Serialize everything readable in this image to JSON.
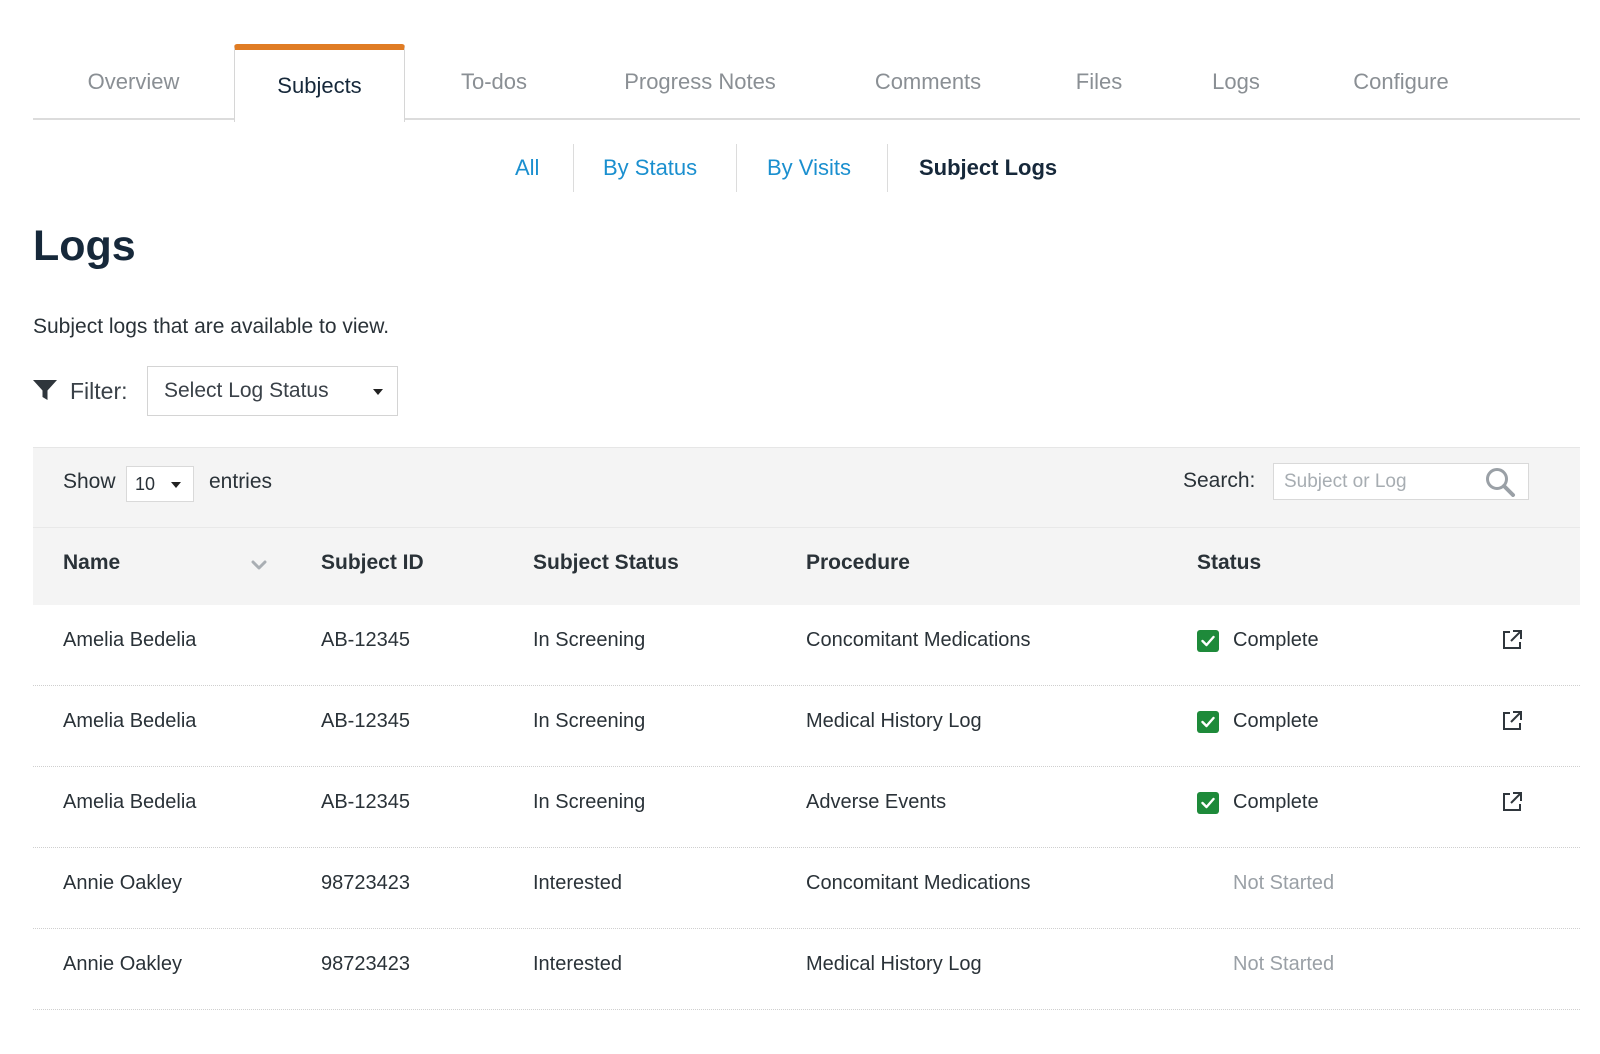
{
  "tabs": [
    {
      "label": "Overview",
      "active": false
    },
    {
      "label": "Subjects",
      "active": true
    },
    {
      "label": "To-dos",
      "active": false
    },
    {
      "label": "Progress Notes",
      "active": false
    },
    {
      "label": "Comments",
      "active": false
    },
    {
      "label": "Files",
      "active": false
    },
    {
      "label": "Logs",
      "active": false
    },
    {
      "label": "Configure",
      "active": false
    }
  ],
  "subtabs": [
    {
      "label": "All",
      "active": false
    },
    {
      "label": "By Status",
      "active": false
    },
    {
      "label": "By Visits",
      "active": false
    },
    {
      "label": "Subject Logs",
      "active": true
    }
  ],
  "page": {
    "title": "Logs",
    "description": "Subject logs that are available to view."
  },
  "filter": {
    "label": "Filter:",
    "select_value": "Select Log Status"
  },
  "table_controls": {
    "show_label": "Show",
    "page_size": "10",
    "entries_label": "entries",
    "search_label": "Search:",
    "search_placeholder": "Subject or Log"
  },
  "table": {
    "columns": [
      "Name",
      "Subject ID",
      "Subject Status",
      "Procedure",
      "Status"
    ],
    "rows": [
      {
        "name": "Amelia Bedelia",
        "subject_id": "AB-12345",
        "subject_status": "In Screening",
        "procedure": "Concomitant Medications",
        "status": "Complete",
        "complete": true
      },
      {
        "name": "Amelia Bedelia",
        "subject_id": "AB-12345",
        "subject_status": "In Screening",
        "procedure": "Medical History Log",
        "status": "Complete",
        "complete": true
      },
      {
        "name": "Amelia Bedelia",
        "subject_id": "AB-12345",
        "subject_status": "In Screening",
        "procedure": "Adverse Events",
        "status": "Complete",
        "complete": true
      },
      {
        "name": "Annie Oakley",
        "subject_id": "98723423",
        "subject_status": "Interested",
        "procedure": "Concomitant Medications",
        "status": "Not Started",
        "complete": false
      },
      {
        "name": "Annie Oakley",
        "subject_id": "98723423",
        "subject_status": "Interested",
        "procedure": "Medical History Log",
        "status": "Not Started",
        "complete": false
      }
    ]
  },
  "colors": {
    "accent": "#e07c24",
    "link": "#1a8fcf",
    "complete": "#1e8a3a",
    "heading": "#16283a"
  },
  "icons": {
    "filter": "filter-icon",
    "search": "search-icon",
    "sort": "chevron-down-icon",
    "check": "check-icon",
    "external": "external-link-icon"
  }
}
